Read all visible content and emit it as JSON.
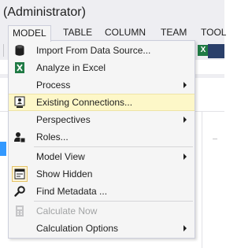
{
  "window": {
    "title": "(Administrator)"
  },
  "menubar": {
    "items": [
      "MODEL",
      "TABLE",
      "COLUMN",
      "TEAM",
      "TOOL"
    ]
  },
  "toolbar": {
    "excel_icon_glyph": "X"
  },
  "subbar": {
    "partial_text": "as"
  },
  "menu": {
    "items": [
      {
        "label": "Import From Data Source...",
        "icon": "database-icon",
        "submenu": false,
        "disabled": false
      },
      {
        "label": "Analyze in Excel",
        "icon": "excel-icon",
        "submenu": false,
        "disabled": false
      },
      {
        "label": "Process",
        "icon": "",
        "submenu": true,
        "disabled": false
      },
      {
        "label": "Existing Connections...",
        "icon": "connections-icon",
        "submenu": false,
        "disabled": false,
        "highlighted": true
      },
      {
        "label": "Perspectives",
        "icon": "",
        "submenu": true,
        "disabled": false
      },
      {
        "label": "Roles...",
        "icon": "roles-icon",
        "submenu": false,
        "disabled": false
      },
      {
        "label": "Model View",
        "icon": "",
        "submenu": true,
        "disabled": false
      },
      {
        "label": "Show Hidden",
        "icon": "show-hidden-icon",
        "submenu": false,
        "disabled": false,
        "checked": true
      },
      {
        "label": "Find Metadata ...",
        "icon": "search-icon",
        "submenu": false,
        "disabled": false
      },
      {
        "label": "Calculate Now",
        "icon": "calculator-icon",
        "submenu": false,
        "disabled": true
      },
      {
        "label": "Calculation Options",
        "icon": "",
        "submenu": true,
        "disabled": false
      }
    ]
  },
  "colors": {
    "menu_background": "#f5f5f5",
    "highlight_background": "#fdf7c8",
    "disabled_text": "#a2a4a5",
    "excel_green": "#1f7a44",
    "selection_blue": "#3399ff"
  }
}
